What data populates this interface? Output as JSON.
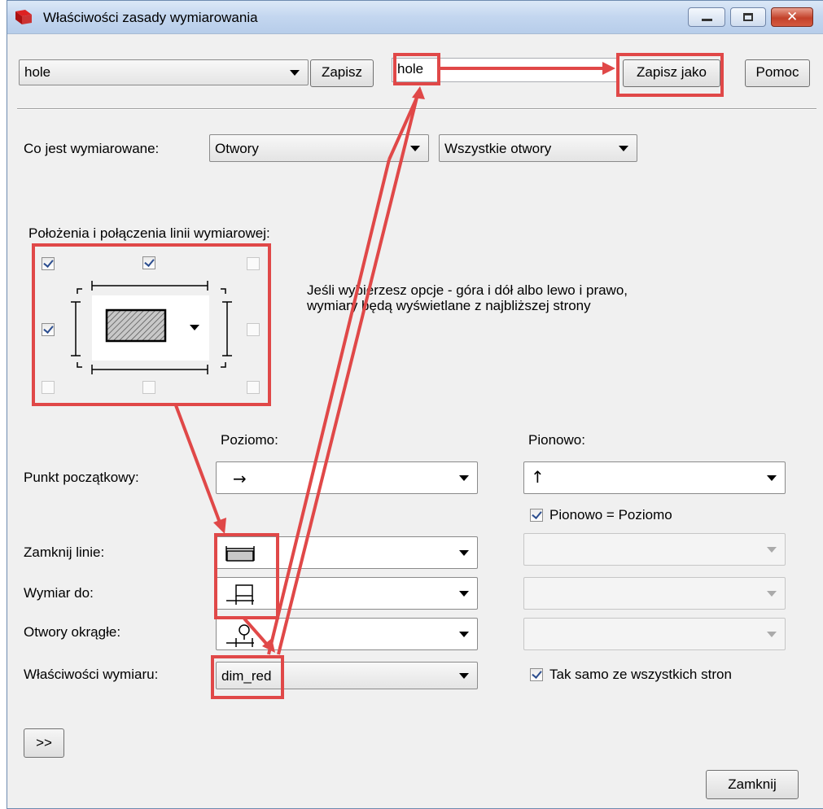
{
  "window": {
    "title": "Właściwości zasady wymiarowania",
    "accent_color": "#e04848"
  },
  "toolbar": {
    "rule_select_value": "hole",
    "save_label": "Zapisz",
    "name_input_value": "hole",
    "save_as_label": "Zapisz jako",
    "help_label": "Pomoc"
  },
  "what_dimensioned": {
    "label": "Co jest wymiarowane:",
    "type_value": "Otwory",
    "scope_value": "Wszystkie otwory"
  },
  "positions": {
    "label": "Położenia i połączenia linii wymiarowej:",
    "hint": "Jeśli wybierzesz opcje - góra i dół albo lewo i prawo, wymiary będą wyświetlane z najbliższej strony",
    "checkboxes": {
      "top_left": true,
      "top_center": true,
      "top_right": false,
      "middle_left": true,
      "middle_right": false,
      "bottom_left": false,
      "bottom_center": false,
      "bottom_right": false
    }
  },
  "columns": {
    "horizontal": "Poziomo:",
    "vertical": "Pionowo:"
  },
  "rows": {
    "start_point_label": "Punkt początkowy:",
    "start_horizontal_icon": "→",
    "start_vertical_icon": "↑",
    "vertical_equals_label": "Pionowo = Poziomo",
    "vertical_equals_checked": true,
    "close_lines_label": "Zamknij linie:",
    "dimension_to_label": "Wymiar do:",
    "round_holes_label": "Otwory okrągłe:",
    "dim_properties_label": "Właściwości wymiaru:",
    "dim_properties_value": "dim_red",
    "same_all_sides_label": "Tak samo ze wszystkich stron",
    "same_all_sides_checked": true
  },
  "footer": {
    "expand_label": ">>",
    "close_label": "Zamknij"
  }
}
